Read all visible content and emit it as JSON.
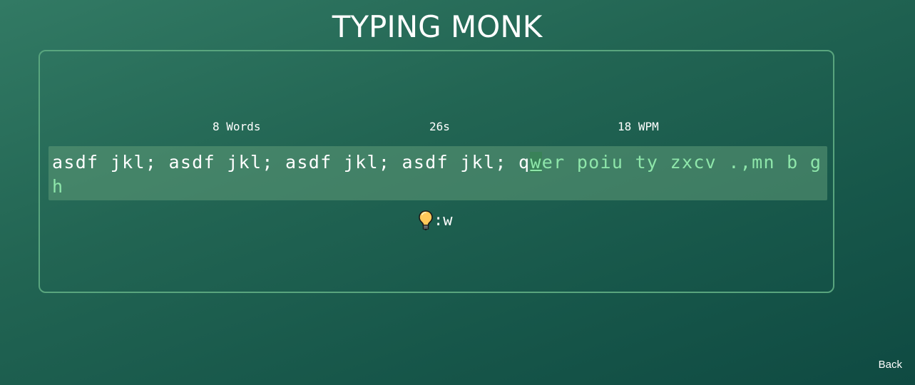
{
  "app": {
    "title": "TYPING MONK"
  },
  "stats": {
    "words": {
      "value": "8",
      "unit": "Words"
    },
    "time": {
      "value": "26s"
    },
    "wpm": {
      "value": "18",
      "unit": "WPM"
    }
  },
  "practice": {
    "typed_text": "asdf jkl; asdf jkl; asdf jkl; asdf jkl; q",
    "current_char": "w",
    "pending_text": "er poiu ty zxcv .,mn b gh"
  },
  "hint": {
    "icon": "lightbulb-icon",
    "label": ":w"
  },
  "nav": {
    "back_label": "Back"
  },
  "colors": {
    "background_start": "#327a64",
    "background_end": "#0f4a42",
    "panel_border": "#59a57e",
    "pending_text": "#8ee6aa",
    "typed_text": "#ffffff"
  }
}
